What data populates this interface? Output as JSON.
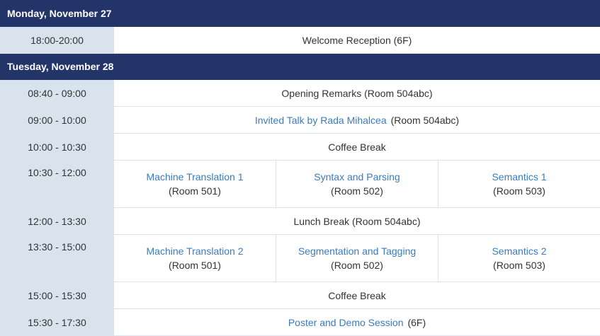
{
  "days": [
    {
      "title": "Monday, November 27"
    },
    {
      "title": "Tuesday, November 28"
    }
  ],
  "mon": {
    "reception": {
      "time": "18:00-20:00",
      "event": "Welcome Reception (6F)"
    }
  },
  "tue": {
    "opening": {
      "time": "08:40 - 09:00",
      "event": "Opening Remarks (Room 504abc)"
    },
    "invited": {
      "time": "09:00 - 10:00",
      "link": "Invited Talk by Rada Mihalcea",
      "room": "(Room 504abc)"
    },
    "coffee1": {
      "time": "10:00 - 10:30",
      "event": "Coffee Break"
    },
    "session1": {
      "time": "10:30 - 12:00",
      "tracks": [
        {
          "title": "Machine Translation 1",
          "room": "(Room 501)"
        },
        {
          "title": "Syntax and Parsing",
          "room": "(Room 502)"
        },
        {
          "title": "Semantics 1",
          "room": "(Room 503)"
        }
      ]
    },
    "lunch": {
      "time": "12:00 - 13:30",
      "event": "Lunch Break (Room 504abc)"
    },
    "session2": {
      "time": "13:30 - 15:00",
      "tracks": [
        {
          "title": "Machine Translation 2",
          "room": "(Room 501)"
        },
        {
          "title": "Segmentation and Tagging",
          "room": "(Room 502)"
        },
        {
          "title": "Semantics 2",
          "room": "(Room 503)"
        }
      ]
    },
    "coffee2": {
      "time": "15:00 - 15:30",
      "event": "Coffee Break"
    },
    "poster": {
      "time": "15:30 - 17:30",
      "link": "Poster and Demo Session",
      "room": "(6F)"
    }
  },
  "colors": {
    "day_header_bg": "#233468",
    "time_cell_bg": "#d9e3ee",
    "link": "#3a7bbf",
    "text": "#333333"
  }
}
